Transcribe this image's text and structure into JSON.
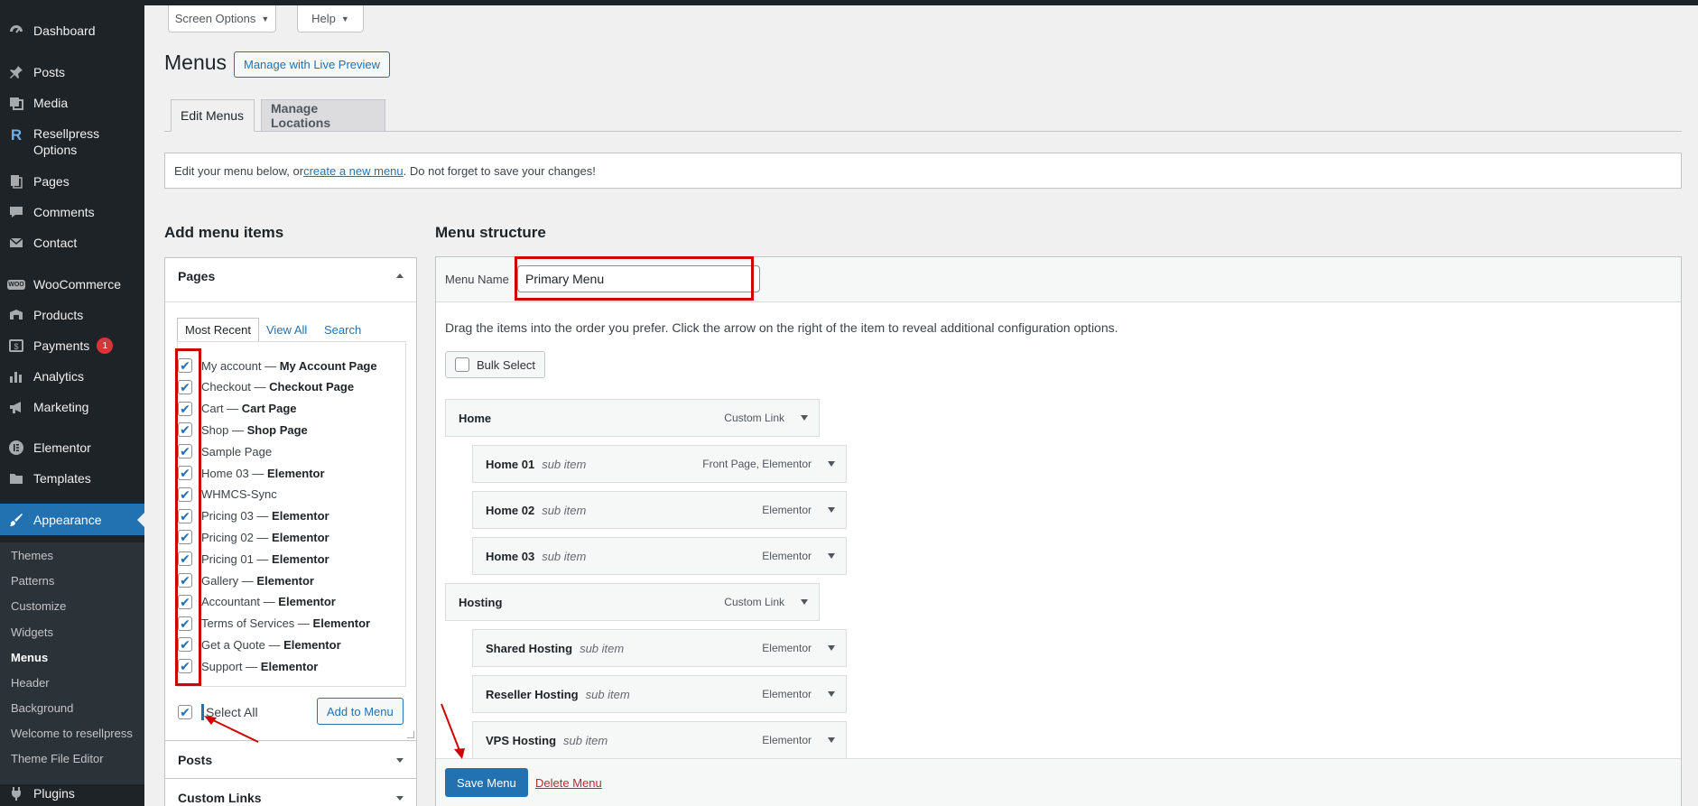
{
  "sidebar": {
    "items": [
      {
        "label": "Dashboard",
        "icon": "dashboard-icon"
      },
      {
        "label": "Posts",
        "icon": "pin-icon"
      },
      {
        "label": "Media",
        "icon": "media-icon"
      },
      {
        "label": "Resellpress Options",
        "icon": "resellpress-icon"
      },
      {
        "label": "Pages",
        "icon": "pages-icon"
      },
      {
        "label": "Comments",
        "icon": "comments-icon"
      },
      {
        "label": "Contact",
        "icon": "mail-icon"
      },
      {
        "label": "WooCommerce",
        "icon": "woocommerce-icon"
      },
      {
        "label": "Products",
        "icon": "products-icon"
      },
      {
        "label": "Payments",
        "icon": "payments-icon",
        "badge": "1"
      },
      {
        "label": "Analytics",
        "icon": "analytics-icon"
      },
      {
        "label": "Marketing",
        "icon": "megaphone-icon"
      },
      {
        "label": "Elementor",
        "icon": "elementor-icon"
      },
      {
        "label": "Templates",
        "icon": "folder-icon"
      },
      {
        "label": "Appearance",
        "icon": "brush-icon"
      },
      {
        "label": "Plugins",
        "icon": "plugin-icon"
      }
    ],
    "submenu": [
      "Themes",
      "Patterns",
      "Customize",
      "Widgets",
      "Menus",
      "Header",
      "Background",
      "Welcome to resellpress",
      "Theme File Editor"
    ]
  },
  "top": {
    "screen_options": "Screen Options",
    "help": "Help",
    "title": "Menus",
    "live_preview": "Manage with Live Preview"
  },
  "tabs": {
    "edit": "Edit Menus",
    "locations": "Manage Locations"
  },
  "notice": {
    "prefix": "Edit your menu below, or ",
    "link": "create a new menu",
    "suffix": ". Do not forget to save your changes!"
  },
  "add_items": {
    "heading": "Add menu items",
    "pages_title": "Pages",
    "tabs": [
      "Most Recent",
      "View All",
      "Search"
    ],
    "pages": [
      {
        "name": "My account",
        "suffix": "My Account Page"
      },
      {
        "name": "Checkout",
        "suffix": "Checkout Page"
      },
      {
        "name": "Cart",
        "suffix": "Cart Page"
      },
      {
        "name": "Shop",
        "suffix": "Shop Page"
      },
      {
        "name": "Sample Page",
        "suffix": ""
      },
      {
        "name": "Home 03",
        "suffix": "Elementor"
      },
      {
        "name": "WHMCS-Sync",
        "suffix": ""
      },
      {
        "name": "Pricing 03",
        "suffix": "Elementor"
      },
      {
        "name": "Pricing 02",
        "suffix": "Elementor"
      },
      {
        "name": "Pricing 01",
        "suffix": "Elementor"
      },
      {
        "name": "Gallery",
        "suffix": "Elementor"
      },
      {
        "name": "Accountant",
        "suffix": "Elementor"
      },
      {
        "name": "Terms of Services",
        "suffix": "Elementor"
      },
      {
        "name": "Get a Quote",
        "suffix": "Elementor"
      },
      {
        "name": "Support",
        "suffix": "Elementor"
      }
    ],
    "dash": " — ",
    "select_all": "Select All",
    "add_button": "Add to Menu",
    "posts_title": "Posts",
    "custom_links_title": "Custom Links"
  },
  "structure": {
    "heading": "Menu structure",
    "menu_name_label": "Menu Name",
    "menu_name_value": "Primary Menu",
    "instructions": "Drag the items into the order you prefer. Click the arrow on the right of the item to reveal additional configuration options.",
    "bulk_select": "Bulk Select",
    "items": [
      {
        "title": "Home",
        "sub": "",
        "type": "Custom Link",
        "level": 0
      },
      {
        "title": "Home 01",
        "sub": "sub item",
        "type": "Front Page, Elementor",
        "level": 1
      },
      {
        "title": "Home 02",
        "sub": "sub item",
        "type": "Elementor",
        "level": 1
      },
      {
        "title": "Home 03",
        "sub": "sub item",
        "type": "Elementor",
        "level": 1
      },
      {
        "title": "Hosting",
        "sub": "",
        "type": "Custom Link",
        "level": 0
      },
      {
        "title": "Shared Hosting",
        "sub": "sub item",
        "type": "Elementor",
        "level": 1
      },
      {
        "title": "Reseller Hosting",
        "sub": "sub item",
        "type": "Elementor",
        "level": 1
      },
      {
        "title": "VPS Hosting",
        "sub": "sub item",
        "type": "Elementor",
        "level": 1
      }
    ],
    "save": "Save Menu",
    "delete": "Delete Menu"
  },
  "colors": {
    "sidebar": "#1d2327",
    "accent": "#2271b1",
    "highlight_red": "#d10000",
    "badge": "#d63638"
  }
}
